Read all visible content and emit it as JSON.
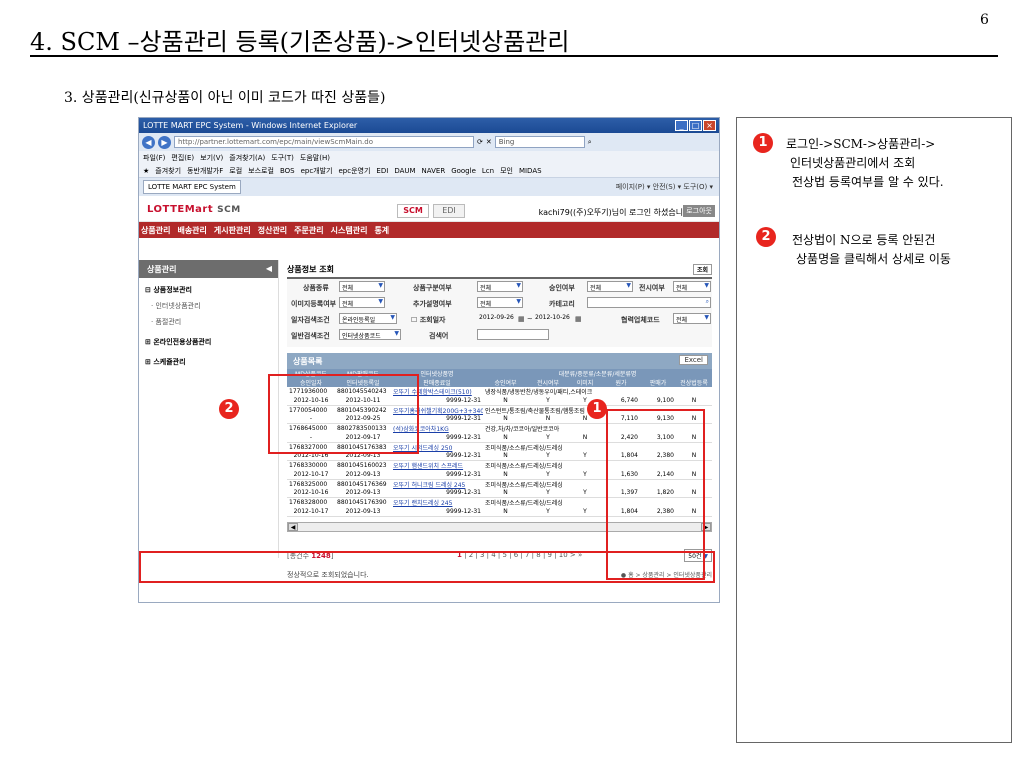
{
  "slide": {
    "title": "4. SCM –상품관리  등록(기존상품)->인터넷상품관리",
    "page_number": "6",
    "subtitle": "3. 상품관리(신규상품이 아닌 이미 코드가 따진 상품들)"
  },
  "browser": {
    "window_title": "LOTTE MART EPC System - Windows Internet Explorer",
    "url": "http://partner.lottemart.com/epc/main/viewScmMain.do",
    "search_placeholder": "Bing",
    "menu": [
      "파일(F)",
      "편집(E)",
      "보기(V)",
      "즐겨찾기(A)",
      "도구(T)",
      "도움말(H)"
    ],
    "favorites": [
      "즐겨찾기",
      "동반개발가F",
      "로컬",
      "보스로컬",
      "BOS",
      "epc개발기",
      "epc운영기",
      "EDI",
      "DAUM",
      "NAVER",
      "Google",
      "Lcn",
      "모인",
      "MIDAS"
    ],
    "tab_label": "LOTTE MART EPC System",
    "tools": "페이지(P) ▾  안전(S) ▾  도구(O) ▾"
  },
  "app": {
    "logo": "LOTTEMart",
    "logo_suffix": "SCM",
    "tab_scm": "SCM",
    "tab_edi": "EDI",
    "login_message": "kachi79((주)오뚜기)님이 로그인 하셨습니다.",
    "logout": "로그아웃",
    "main_menu": [
      "상품관리",
      "배송관리",
      "게시판관리",
      "정산관리",
      "주문관리",
      "시스템관리",
      "통계"
    ]
  },
  "sidebar": {
    "title": "상품관리",
    "items": [
      {
        "label": "상품정보관리",
        "type": "group"
      },
      {
        "label": "인터넷상품관리",
        "type": "sub"
      },
      {
        "label": "품절관리",
        "type": "sub"
      },
      {
        "label": "온라인전용상품관리",
        "type": "group"
      },
      {
        "label": "스케쥴관리",
        "type": "group"
      }
    ]
  },
  "search_form": {
    "title": "상품정보 조회",
    "lookup_button": "조회",
    "labels": {
      "product_type": "상품종류",
      "product_class": "상품구분여부",
      "approval": "승인여부",
      "display": "전시여부",
      "image_reg": "이미지등록여부",
      "add_desc": "추가설명여부",
      "category": "카테고리",
      "date_cond": "일자검색조건",
      "lookup_date": "조회일자",
      "partner_code": "협력업체코드",
      "general_cond": "일반검색조건",
      "keyword": "검색어"
    },
    "values": {
      "product_type": "전체",
      "product_class": "전체",
      "approval": "전체",
      "display": "전체",
      "image_reg": "전체",
      "add_desc": "전체",
      "date_cond": "온라인등록일",
      "date_from": "2012-09-26",
      "date_to": "2012-10-26",
      "partner_code": "전체",
      "general_cond": "인터넷상품코드",
      "keyword": ""
    }
  },
  "grid": {
    "title": "상품목록",
    "excel_button": "Excel",
    "header1": [
      "MD상품코드",
      "MD판매코드",
      "인터넷상품명",
      "대분류/중분류/소분류/세분류명",
      "",
      "",
      "",
      "",
      ""
    ],
    "header2": [
      "승인일자",
      "인터넷등록일",
      "판매종료일",
      "승인여부",
      "전시여부",
      "이미지",
      "원가",
      "판매가",
      "전상법등록"
    ],
    "rows": [
      {
        "md_code": "1771936000",
        "sale_code": "8801045540243",
        "name": "오뚜기 수제함박스테이크(510)",
        "category": "냉장식품/냉동반찬/냉동우이/패티,스테이크",
        "approve_date": "2012-10-16",
        "reg_date": "2012-10-11",
        "end_date": "9999-12-31",
        "approved": "N",
        "display": "Y",
        "image": "Y",
        "cost": "6,740",
        "price": "9,100",
        "law": "N"
      },
      {
        "md_code": "1770054000",
        "sale_code": "8801045390242",
        "name": "오뚜기홈래쉬챌기획200G+3+340",
        "category": "인스턴트/통조림/축산물통조림/햄통조림",
        "approve_date": "-",
        "reg_date": "2012-09-25",
        "end_date": "9999-12-31",
        "approved": "N",
        "display": "N",
        "image": "N",
        "cost": "7,110",
        "price": "9,130",
        "law": "N"
      },
      {
        "md_code": "1768645000",
        "sale_code": "8802783500133",
        "name": "(석)삼화코코아차1KG",
        "category": "건강,차/차/코코아/일반코코아",
        "approve_date": "-",
        "reg_date": "2012-09-17",
        "end_date": "9999-12-31",
        "approved": "N",
        "display": "Y",
        "image": "N",
        "cost": "2,420",
        "price": "3,100",
        "law": "N"
      },
      {
        "md_code": "1768327000",
        "sale_code": "8801045176383",
        "name": "오뚜기 시저드레싱 250",
        "category": "조미식품/소스류/드레싱/드레싱",
        "approve_date": "2012-10-16",
        "reg_date": "2012-09-13",
        "end_date": "9999-12-31",
        "approved": "N",
        "display": "Y",
        "image": "Y",
        "cost": "1,804",
        "price": "2,380",
        "law": "N"
      },
      {
        "md_code": "1768330000",
        "sale_code": "8801045160023",
        "name": "오뚜기 햄샌드위치 스프레드",
        "category": "조미식품/소스류/드레싱/드레싱",
        "approve_date": "2012-10-17",
        "reg_date": "2012-09-13",
        "end_date": "9999-12-31",
        "approved": "N",
        "display": "Y",
        "image": "Y",
        "cost": "1,630",
        "price": "2,140",
        "law": "N"
      },
      {
        "md_code": "1768325000",
        "sale_code": "8801045176369",
        "name": "오뚜기 허니크림 드레싱 245",
        "category": "조미식품/소스류/드레싱/드레싱",
        "approve_date": "2012-10-16",
        "reg_date": "2012-09-13",
        "end_date": "9999-12-31",
        "approved": "N",
        "display": "Y",
        "image": "Y",
        "cost": "1,397",
        "price": "1,820",
        "law": "N"
      },
      {
        "md_code": "1768328000",
        "sale_code": "8801045176390",
        "name": "오뚜기 랜치드레싱 245",
        "category": "조미식품/소스류/드레싱/드레싱",
        "approve_date": "2012-10-17",
        "reg_date": "2012-09-13",
        "end_date": "9999-12-31",
        "approved": "N",
        "display": "Y",
        "image": "Y",
        "cost": "1,804",
        "price": "2,380",
        "law": "N"
      }
    ]
  },
  "pager": {
    "total_prefix": "[총건수 ",
    "total_count": "1248",
    "total_suffix": "]",
    "current_page": "1",
    "other_pages": "| 2 | 3 | 4 | 5 | 6 | 7 | 8 | 9 | 10   > »",
    "page_size": "50건"
  },
  "status": {
    "message": "정상적으로 조회되었습니다.",
    "breadcrumb": "● 홈 > 상품관리 > 인터넷상품관리"
  },
  "markers": [
    "1",
    "2"
  ],
  "notes": {
    "note1_lines": [
      "로그인->SCM->상품관리->",
      "인터넷상품관리에서 조회",
      "전상법 등록여부를 알 수 있다."
    ],
    "note2_lines": [
      "전상법이 N으로 등록 안된건",
      "상품명을 클릭해서 상세로 이동"
    ]
  },
  "colors": {
    "accent_red": "#e8251e",
    "menu_red": "#b12a2a",
    "grid_header": "#7a97b9",
    "link_blue": "#1a3fa8"
  }
}
